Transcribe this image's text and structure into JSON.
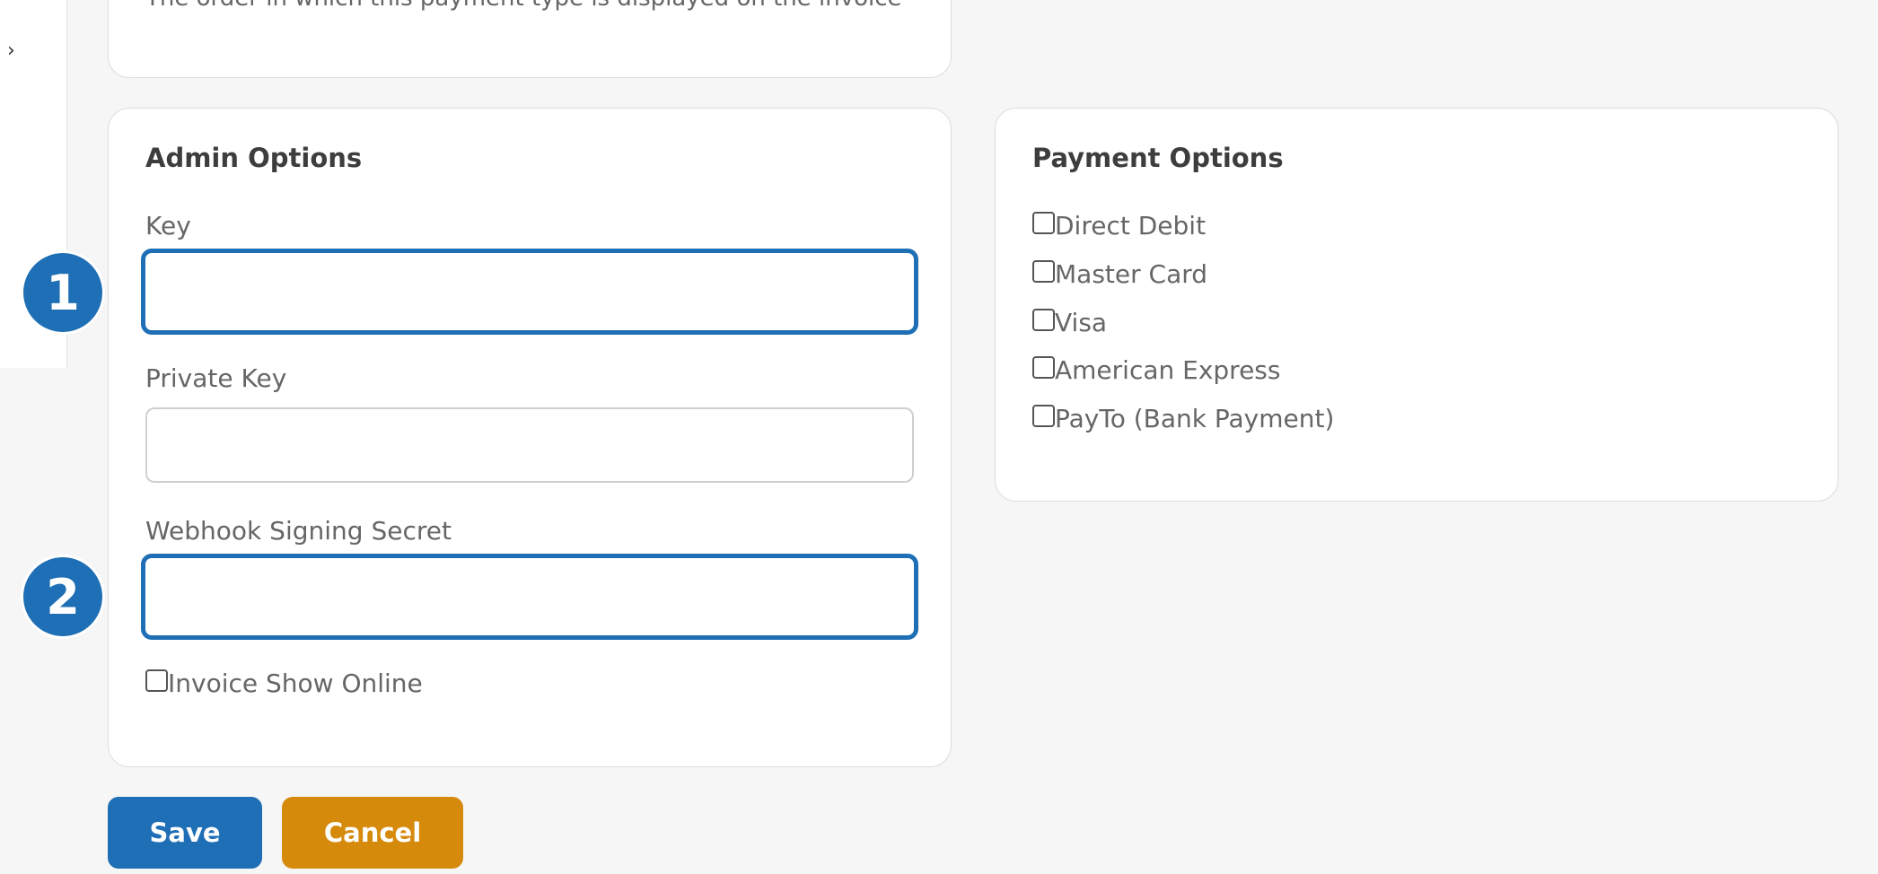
{
  "sidebar": {
    "toggle_icon": "chevron-right-icon",
    "toggle_glyph": "›"
  },
  "top_card": {
    "description": "The order in which this payment type is displayed on the invoice"
  },
  "admin_options": {
    "title": "Admin Options",
    "fields": [
      {
        "label": "Key",
        "value": "",
        "placeholder": ""
      },
      {
        "label": "Private Key",
        "value": "",
        "placeholder": ""
      },
      {
        "label": "Webhook Signing Secret",
        "value": "",
        "placeholder": ""
      }
    ],
    "invoice_show_online": {
      "label": "Invoice Show Online",
      "checked": false
    }
  },
  "payment_options": {
    "title": "Payment Options",
    "items": [
      {
        "label": "Direct Debit",
        "checked": false
      },
      {
        "label": "Master Card",
        "checked": false
      },
      {
        "label": "Visa",
        "checked": false
      },
      {
        "label": "American Express",
        "checked": false
      },
      {
        "label": "PayTo (Bank Payment)",
        "checked": false
      }
    ]
  },
  "annotations": {
    "badge_1": "1",
    "badge_2": "2"
  },
  "actions": {
    "save_label": "Save",
    "cancel_label": "Cancel"
  },
  "colors": {
    "primary": "#1e6fb5",
    "cancel": "#d68a0c",
    "background": "#f6f6f6"
  }
}
